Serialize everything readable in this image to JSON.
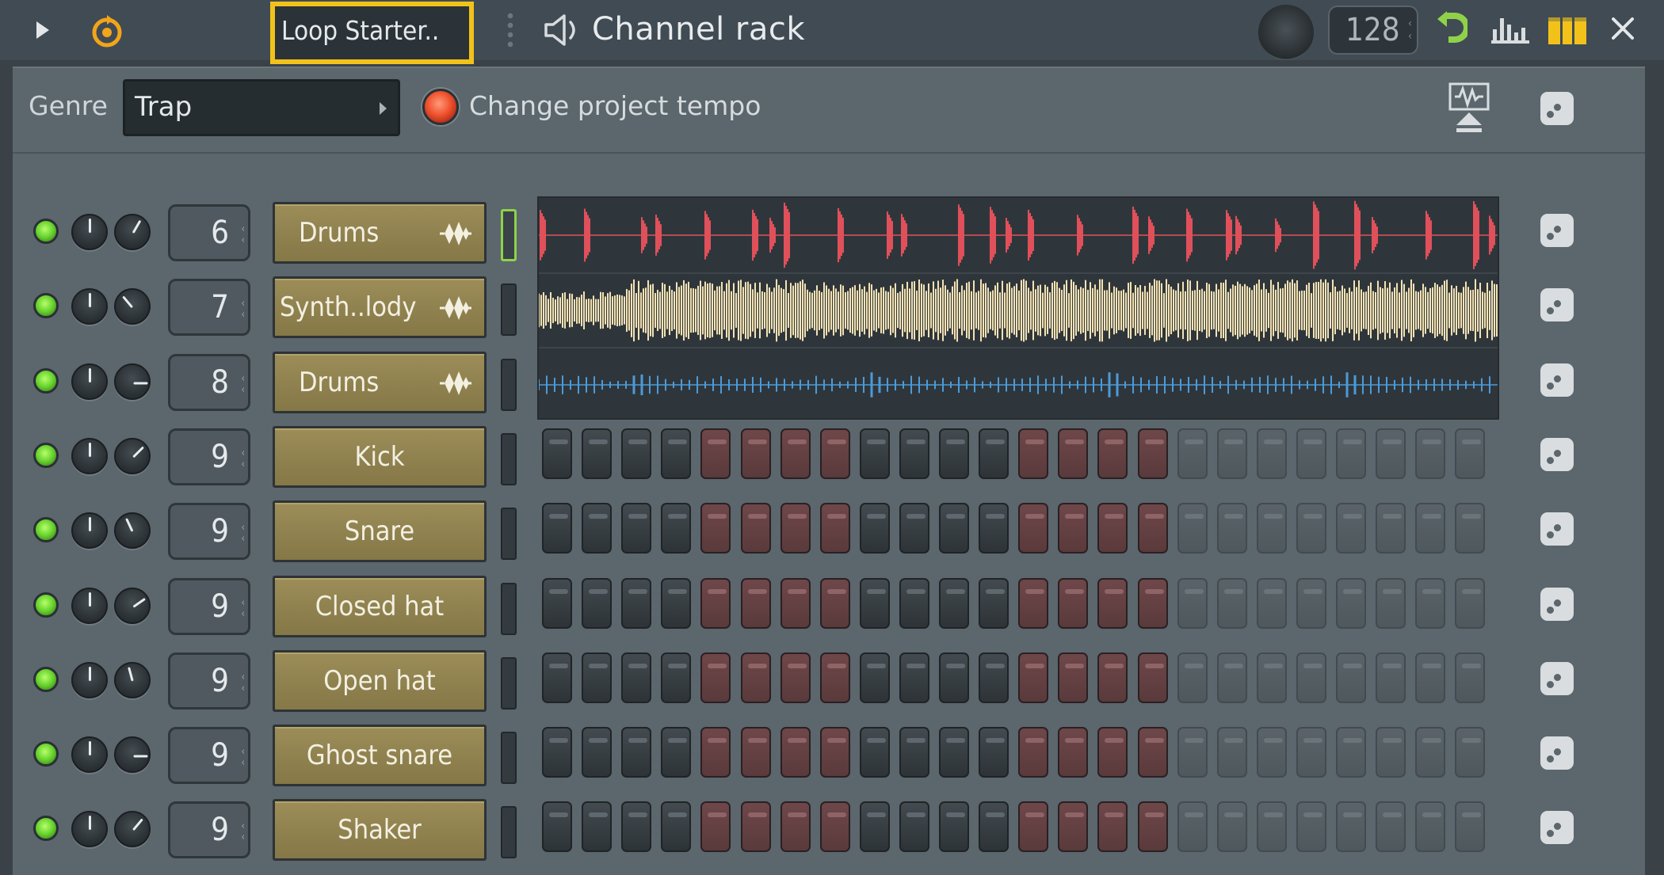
{
  "titlebar": {
    "pattern_name": "Loop Starter..",
    "window_title": "Channel rack",
    "tempo_value": "128",
    "colors": {
      "pattern_highlight": "#f2c21b",
      "undo": "#8fd24a",
      "tool_yellow": "#f2c21b"
    }
  },
  "toolbar": {
    "genre_label": "Genre",
    "genre_value": "Trap",
    "tempo_toggle_label": "Change project tempo"
  },
  "channels": [
    {
      "name": "Drums",
      "mixer": "6",
      "type": "audio",
      "wave_color": "#e0505a",
      "knob2_angle": 30
    },
    {
      "name": "Synth..lody",
      "mixer": "7",
      "type": "audio",
      "wave_color": "#f5e3b5",
      "knob2_angle": -40
    },
    {
      "name": "Drums",
      "mixer": "8",
      "type": "audio",
      "wave_color": "#4c9bd8",
      "knob2_angle": 90
    },
    {
      "name": "Kick",
      "mixer": "9",
      "type": "steps",
      "knob2_angle": 45
    },
    {
      "name": "Snare",
      "mixer": "9",
      "type": "steps",
      "knob2_angle": -25
    },
    {
      "name": "Closed hat",
      "mixer": "9",
      "type": "steps",
      "knob2_angle": 55
    },
    {
      "name": "Open hat",
      "mixer": "9",
      "type": "steps",
      "knob2_angle": -15
    },
    {
      "name": "Ghost snare",
      "mixer": "9",
      "type": "steps",
      "knob2_angle": 90
    },
    {
      "name": "Shaker",
      "mixer": "9",
      "type": "steps",
      "knob2_angle": 40
    }
  ],
  "steps_per_row": 24,
  "step_colors": {
    "group_a": "#434b50",
    "group_b": "#6e4749",
    "inactive": "#5a6369"
  },
  "icons": {
    "play": "play-icon",
    "loop": "loop-record-icon",
    "speaker": "speaker-icon",
    "undo": "undo-icon",
    "graph": "graph-editor-icon",
    "bars": "picker-icon",
    "close": "close-icon",
    "dice": "dice-icon",
    "waveform": "waveform-icon"
  }
}
